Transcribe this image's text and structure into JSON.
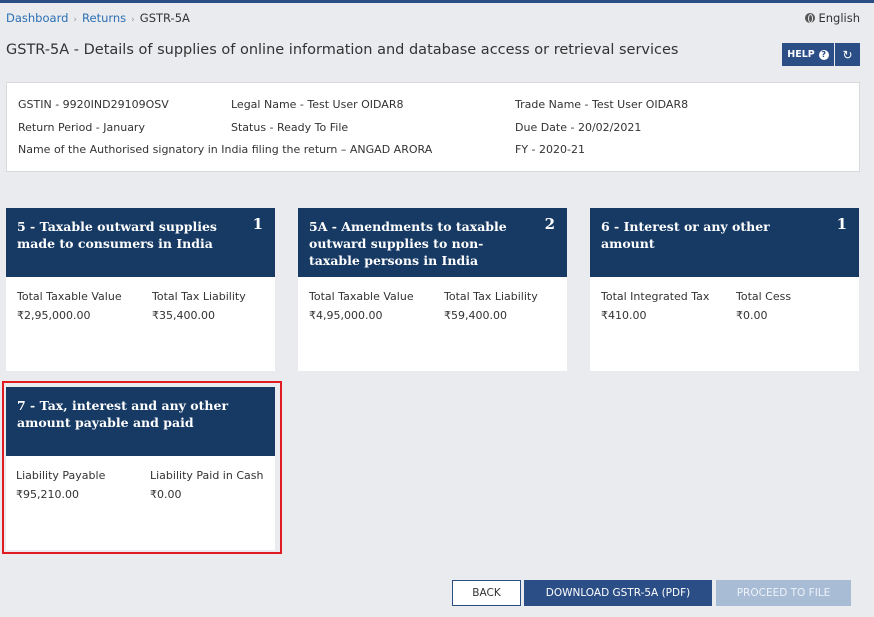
{
  "breadcrumb": {
    "dashboard": "Dashboard",
    "returns": "Returns",
    "current": "GSTR-5A"
  },
  "language": "English",
  "page_title": "GSTR-5A - Details of supplies of online information and database access or retrieval services",
  "header_buttons": {
    "help": "HELP",
    "help_icon": "?",
    "refresh_icon": "↻"
  },
  "info": {
    "gstin": "GSTIN - 9920IND29109OSV",
    "legal_name": "Legal Name - Test User OIDAR8",
    "trade_name": "Trade Name - Test User OIDAR8",
    "return_period": "Return Period - January",
    "status": "Status - Ready To File",
    "due_date": "Due Date - 20/02/2021",
    "signatory": "Name of the Authorised signatory in India filing the return – ANGAD ARORA",
    "fy": "FY - 2020-21"
  },
  "cards": [
    {
      "title": "5 - Taxable outward supplies made to consumers in India",
      "count": "1",
      "label1": "Total Taxable Value",
      "value1": "₹2,95,000.00",
      "label2": "Total Tax Liability",
      "value2": "₹35,400.00"
    },
    {
      "title": "5A - Amendments to taxable outward supplies to non-taxable persons in India",
      "count": "2",
      "label1": "Total Taxable Value",
      "value1": "₹4,95,000.00",
      "label2": "Total Tax Liability",
      "value2": "₹59,400.00"
    },
    {
      "title": "6 - Interest or any other amount",
      "count": "1",
      "label1": "Total Integrated Tax",
      "value1": "₹410.00",
      "label2": "Total Cess",
      "value2": "₹0.00"
    },
    {
      "title": "7 - Tax, interest and any other amount payable and paid",
      "count": "",
      "label1": "Liability Payable",
      "value1": "₹95,210.00",
      "label2": "Liability Paid in Cash",
      "value2": "₹0.00"
    }
  ],
  "footer": {
    "back": "BACK",
    "download": "DOWNLOAD GSTR-5A (PDF)",
    "proceed": "PROCEED TO FILE"
  }
}
